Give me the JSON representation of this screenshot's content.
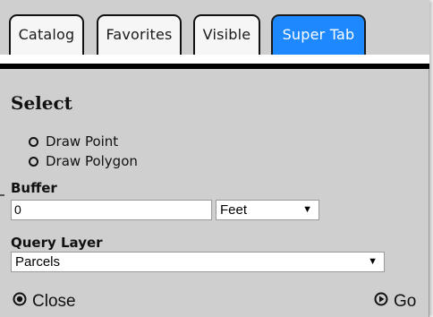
{
  "tabs": [
    {
      "label": "Catalog",
      "active": false
    },
    {
      "label": "Favorites",
      "active": false
    },
    {
      "label": "Visible",
      "active": false
    },
    {
      "label": "Super Tab",
      "active": true
    }
  ],
  "select": {
    "title": "Select",
    "options": [
      "Draw Point",
      "Draw Polygon"
    ]
  },
  "buffer": {
    "label": "Buffer",
    "value": "0",
    "unit": "Feet"
  },
  "query_layer": {
    "label": "Query Layer",
    "value": "Parcels"
  },
  "footer": {
    "close_label": "Close",
    "go_label": "Go"
  },
  "colors": {
    "active_tab": "#1e88ff",
    "panel_bg": "#cfcfcf"
  },
  "icons": {
    "close": "close-circle-icon",
    "go": "play-circle-icon",
    "dropdown": "triangle-down-icon"
  }
}
